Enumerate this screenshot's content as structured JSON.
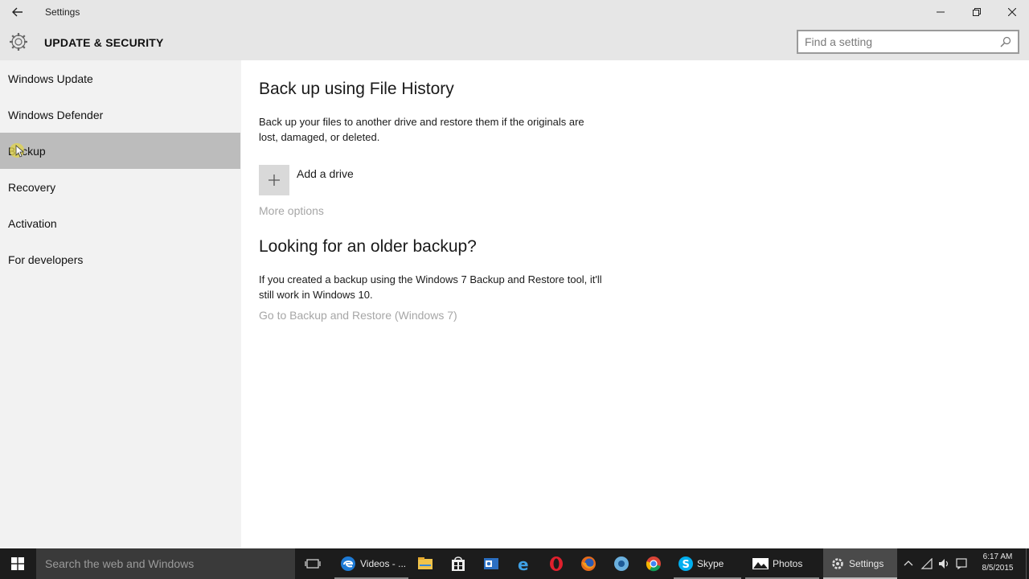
{
  "window": {
    "app_title": "Settings",
    "section_title": "UPDATE & SECURITY"
  },
  "search": {
    "placeholder": "Find a setting"
  },
  "sidebar": {
    "items": [
      {
        "label": "Windows Update",
        "selected": false
      },
      {
        "label": "Windows Defender",
        "selected": false
      },
      {
        "label": "Backup",
        "selected": true
      },
      {
        "label": "Recovery",
        "selected": false
      },
      {
        "label": "Activation",
        "selected": false
      },
      {
        "label": "For developers",
        "selected": false
      }
    ]
  },
  "main": {
    "file_history": {
      "heading": "Back up using File History",
      "description": "Back up your files to another drive and restore them if the originals are lost, damaged, or deleted.",
      "add_drive_label": "Add a drive",
      "more_options_link": "More options"
    },
    "older_backup": {
      "heading": "Looking for an older backup?",
      "description": "If you created a backup using the Windows 7 Backup and Restore tool, it'll still work in Windows 10.",
      "link": "Go to Backup and Restore (Windows 7)"
    }
  },
  "taskbar": {
    "search_placeholder": "Search the web and Windows",
    "apps": [
      {
        "name": "edge",
        "label": "Videos - ..."
      },
      {
        "name": "file-explorer",
        "label": ""
      },
      {
        "name": "store",
        "label": ""
      },
      {
        "name": "outlook",
        "label": ""
      },
      {
        "name": "internet-explorer",
        "label": ""
      },
      {
        "name": "opera",
        "label": ""
      },
      {
        "name": "firefox",
        "label": ""
      },
      {
        "name": "chrome-app",
        "label": ""
      },
      {
        "name": "chrome",
        "label": ""
      },
      {
        "name": "skype",
        "label": "Skype"
      },
      {
        "name": "photos",
        "label": "Photos"
      },
      {
        "name": "settings",
        "label": "Settings"
      }
    ],
    "clock": {
      "time": "6:17 AM",
      "date": "8/5/2015"
    }
  },
  "colors": {
    "titlebar_bg": "#e6e6e6",
    "sidebar_bg": "#f2f2f2",
    "selected_bg": "#bcbcbc",
    "taskbar_bg": "#1c1c1c",
    "link_disabled": "#a6a6a6"
  }
}
